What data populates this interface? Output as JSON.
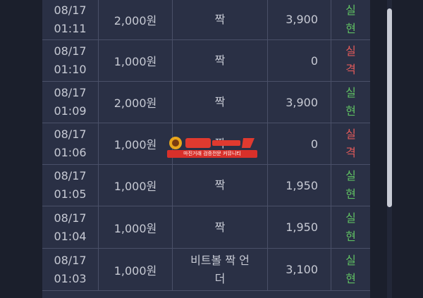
{
  "rows": [
    {
      "date": "08/17",
      "time": "01:11",
      "amount": "2,000원",
      "pick_line1": "짝",
      "pick_line2": "",
      "payout": "3,900",
      "result_line1": "실",
      "result_line2": "현",
      "result_type": "win"
    },
    {
      "date": "08/17",
      "time": "01:10",
      "amount": "1,000원",
      "pick_line1": "짝",
      "pick_line2": "",
      "payout": "0",
      "result_line1": "실",
      "result_line2": "격",
      "result_type": "lose"
    },
    {
      "date": "08/17",
      "time": "01:09",
      "amount": "2,000원",
      "pick_line1": "짝",
      "pick_line2": "",
      "payout": "3,900",
      "result_line1": "실",
      "result_line2": "현",
      "result_type": "win"
    },
    {
      "date": "08/17",
      "time": "01:06",
      "amount": "1,000원",
      "pick_line1": "짝",
      "pick_line2": "",
      "payout": "0",
      "result_line1": "실",
      "result_line2": "격",
      "result_type": "lose"
    },
    {
      "date": "08/17",
      "time": "01:05",
      "amount": "1,000원",
      "pick_line1": "짝",
      "pick_line2": "",
      "payout": "1,950",
      "result_line1": "실",
      "result_line2": "현",
      "result_type": "win"
    },
    {
      "date": "08/17",
      "time": "01:04",
      "amount": "1,000원",
      "pick_line1": "짝",
      "pick_line2": "",
      "payout": "1,950",
      "result_line1": "실",
      "result_line2": "현",
      "result_type": "win"
    },
    {
      "date": "08/17",
      "time": "01:03",
      "amount": "1,000원",
      "pick_line1": "비트볼 짝 언",
      "pick_line2": "더",
      "payout": "3,100",
      "result_line1": "실",
      "result_line2": "현",
      "result_type": "win"
    }
  ],
  "watermark": {
    "text": "마진거래 검증전문 커뮤니티"
  },
  "colors": {
    "win": "#5fbf62",
    "lose": "#e05a5a",
    "panel": "#2a3045",
    "background": "#1b1f2c"
  }
}
